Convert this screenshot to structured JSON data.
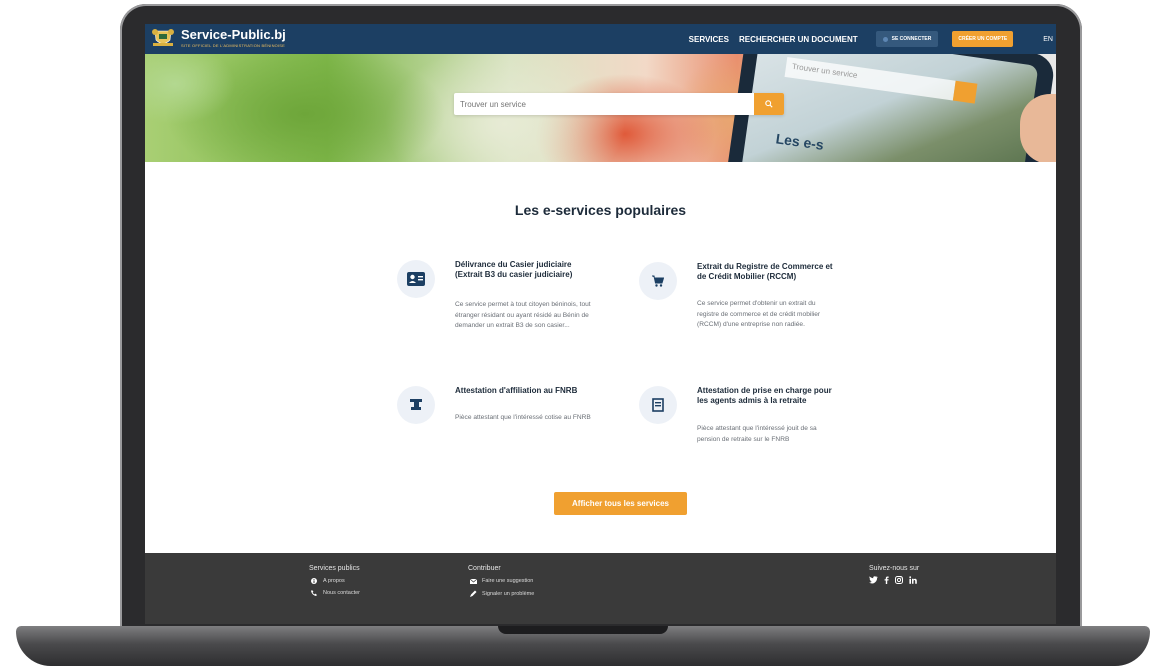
{
  "header": {
    "logo_title": "Service-Public.bj",
    "logo_subtitle": "SITE OFFICIEL DE L'ADMINISTRATION BÉNINOISE",
    "nav_services": "SERVICES",
    "nav_search_document": "RECHERCHER UN DOCUMENT",
    "login_label": "SE CONNECTER",
    "signup_label": "CRÉER UN COMPTE",
    "language": "EN"
  },
  "hero": {
    "search_placeholder": "Trouver un service",
    "phone_search_text": "Trouver un service",
    "phone_title": "Les e-s"
  },
  "main": {
    "section_title": "Les e-services populaires",
    "cards": [
      {
        "title": "Délivrance du Casier judiciaire (Extrait B3 du casier judiciaire)",
        "description": "Ce service permet à tout citoyen béninois, tout étranger résidant ou ayant résidé au Bénin de demander un extrait B3 de son casier...",
        "icon": "id-card-icon"
      },
      {
        "title": "Extrait du Registre de Commerce et de Crédit Mobilier (RCCM)",
        "description": "Ce service permet d'obtenir un extrait du registre de commerce et de crédit mobilier (RCCM) d'une entreprise non radiée.",
        "icon": "cart-icon"
      },
      {
        "title": "Attestation d'affiliation au FNRB",
        "description": "Pièce attestant que l'intéressé cotise au FNRB",
        "icon": "stamp-icon"
      },
      {
        "title": "Attestation de prise en charge pour les agents admis à la retraite",
        "description": "Pièce attestant que l'intéressé jouit de sa pension de retraite sur le FNRB",
        "icon": "certificate-icon"
      }
    ],
    "cta_label": "Afficher tous les services"
  },
  "footer": {
    "col1_title": "Services publics",
    "col1_links": [
      "A propos",
      "Nous contacter"
    ],
    "col2_title": "Contribuer",
    "col2_links": [
      "Faire une suggestion",
      "Signaler un problème"
    ],
    "social_title": "Suivez-nous sur",
    "social_icons": [
      "twitter-icon",
      "facebook-icon",
      "instagram-icon",
      "linkedin-icon"
    ]
  },
  "colors": {
    "header_bg": "#1c3f63",
    "accent": "#f0a030",
    "footer_bg": "#3a3a3a"
  }
}
